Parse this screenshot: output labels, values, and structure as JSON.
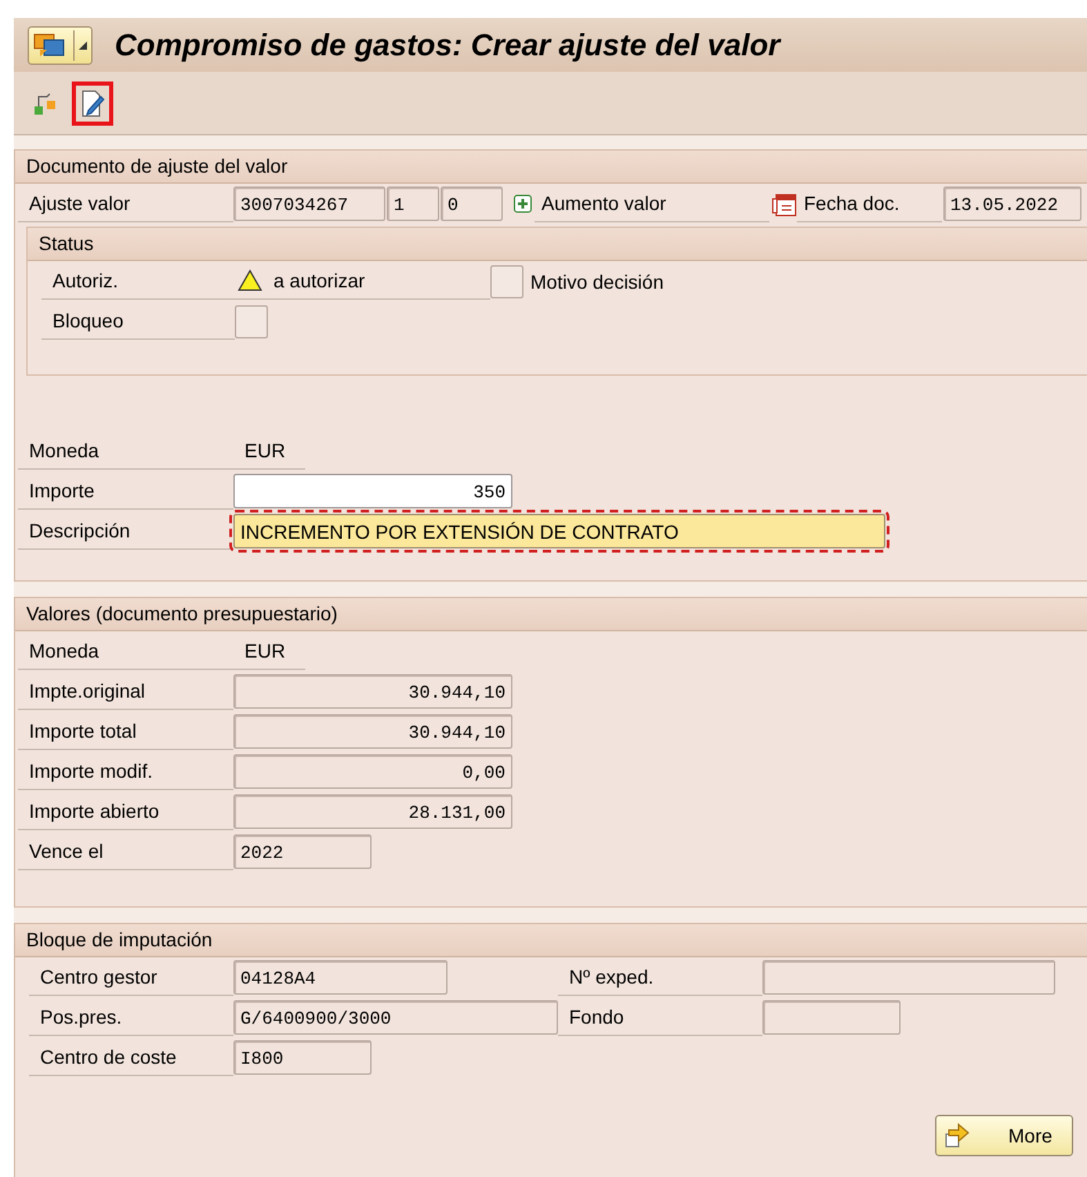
{
  "title": "Compromiso de gastos: Crear ajuste del valor",
  "toolbar": [
    {
      "kind": "hierarchy",
      "highlighted": false
    },
    {
      "kind": "edit",
      "highlighted": true
    }
  ],
  "document": {
    "title": "Documento de ajuste del valor",
    "label": "Ajuste valor",
    "fields": [
      "3007034267",
      "1",
      "0"
    ],
    "type_text": "Aumento valor",
    "date_label": "Fecha doc.",
    "date": "13.05.2022",
    "status": {
      "title": "Status",
      "auth_label": "Autoriz.",
      "auth_value": "a autorizar",
      "reason_label": "Motivo decisión",
      "reason_checked": false,
      "block_label": "Bloqueo",
      "block_checked": false
    },
    "currency_label": "Moneda",
    "currency": "EUR",
    "amount_label": "Importe",
    "amount": "350",
    "description_label": "Descripción",
    "description": "INCREMENTO POR EXTENSIÓN DE CONTRATO"
  },
  "values": {
    "title": "Valores (documento presupuestario)",
    "currency_label": "Moneda",
    "currency": "EUR",
    "rows": [
      {
        "label": "Impte.original",
        "value": "30.944,10"
      },
      {
        "label": "Importe total",
        "value": "30.944,10"
      },
      {
        "label": "Importe modif.",
        "value": "0,00"
      },
      {
        "label": "Importe abierto",
        "value": "28.131,00"
      }
    ],
    "due_label": "Vence el",
    "due": "2022"
  },
  "assignment": {
    "title": "Bloque de imputación",
    "rows": [
      {
        "label": "Centro gestor",
        "value": "04128A4",
        "right_label": "Nº exped."
      },
      {
        "label": "Pos.pres.",
        "value": "G/6400900/3000",
        "right_label": "Fondo"
      },
      {
        "label": "Centro de coste",
        "value": "I800"
      }
    ]
  },
  "more_button": "More"
}
